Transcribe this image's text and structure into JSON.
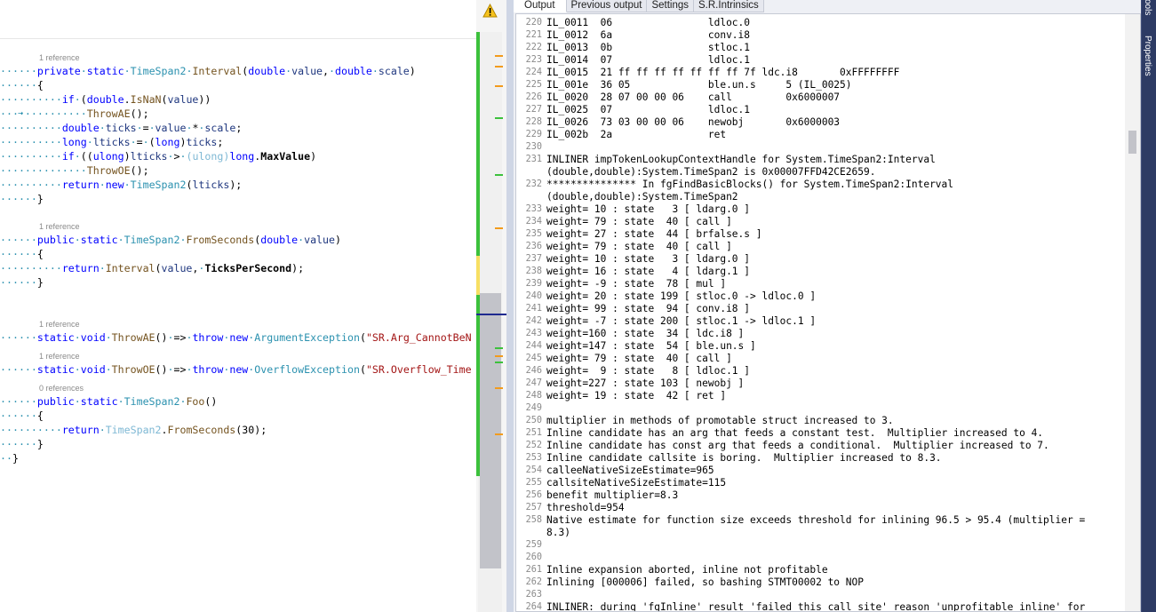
{
  "editor": {
    "lines": [
      {
        "kind": "lens",
        "text": "1 reference"
      },
      {
        "kind": "code",
        "id": "interval-sig"
      },
      {
        "kind": "code",
        "id": "brace1"
      },
      {
        "kind": "code",
        "id": "isnan"
      },
      {
        "kind": "code",
        "id": "throwae-call"
      },
      {
        "kind": "code",
        "id": "ticks"
      },
      {
        "kind": "code",
        "id": "lticks"
      },
      {
        "kind": "code",
        "id": "if-max"
      },
      {
        "kind": "code",
        "id": "throwoe-call"
      },
      {
        "kind": "code",
        "id": "return-new"
      },
      {
        "kind": "code",
        "id": "brace1-close"
      }
    ],
    "lens_interval": "1 reference",
    "lens_fromseconds": "1 reference",
    "lens_throwae": "1 reference",
    "lens_throwoe": "1 reference",
    "lens_foo": "0 references",
    "code": {
      "interval_kw1": "private",
      "interval_kw2": "static",
      "interval_type": "TimeSpan2",
      "interval_name": "Interval",
      "interval_double1": "double",
      "interval_p1": "value",
      "interval_double2": "double",
      "interval_p2": "scale",
      "if1": "if",
      "isnan_double": "double",
      "isnan_method": "IsNaN",
      "isnan_arg": "value",
      "throwae": "ThrowAE",
      "ticks_type": "double",
      "ticks_var": "ticks",
      "ticks_value": "value",
      "ticks_scale": "scale",
      "lticks_type": "long",
      "lticks_var": "lticks",
      "lticks_cast": "long",
      "lticks_src": "ticks",
      "if2": "if",
      "ulong1": "ulong",
      "if2_var": "lticks",
      "ulong2": "ulong",
      "long_kw": "long",
      "maxvalue": "MaxValue",
      "throwoe": "ThrowOE",
      "return1": "return",
      "new1": "new",
      "ret_type": "TimeSpan2",
      "ret_arg": "lticks",
      "fs_kw1": "public",
      "fs_kw2": "static",
      "fs_type": "TimeSpan2",
      "fs_name": "FromSeconds",
      "fs_double": "double",
      "fs_p": "value",
      "return2": "return",
      "fs_call": "Interval",
      "fs_arg1": "value",
      "fs_arg2": "TicksPerSecond",
      "ae_kw1": "static",
      "ae_kw2": "void",
      "ae_name": "ThrowAE",
      "ae_throw": "throw",
      "ae_new": "new",
      "ae_type": "ArgumentException",
      "ae_str": "\"SR.Arg_CannotBeN",
      "oe_kw1": "static",
      "oe_kw2": "void",
      "oe_name": "ThrowOE",
      "oe_throw": "throw",
      "oe_new": "new",
      "oe_type": "OverflowException",
      "oe_str": "\"SR.Overflow_Time",
      "foo_kw1": "public",
      "foo_kw2": "static",
      "foo_type": "TimeSpan2",
      "foo_name": "Foo",
      "return3": "return",
      "foo_ret_type": "TimeSpan2",
      "foo_ret_method": "FromSeconds",
      "foo_ret_arg": "30"
    }
  },
  "output": {
    "tabs": [
      "Output",
      "Previous output",
      "Settings",
      "S.R.Intrinsics"
    ],
    "active_tab": "Output",
    "lines": [
      {
        "n": "220",
        "t": "IL_0011  06                ldloc.0"
      },
      {
        "n": "221",
        "t": "IL_0012  6a                conv.i8"
      },
      {
        "n": "222",
        "t": "IL_0013  0b                stloc.1"
      },
      {
        "n": "223",
        "t": "IL_0014  07                ldloc.1"
      },
      {
        "n": "224",
        "t": "IL_0015  21 ff ff ff ff ff ff ff 7f ldc.i8       0xFFFFFFFF"
      },
      {
        "n": "225",
        "t": "IL_001e  36 05             ble.un.s     5 (IL_0025)"
      },
      {
        "n": "226",
        "t": "IL_0020  28 07 00 00 06    call         0x6000007"
      },
      {
        "n": "227",
        "t": "IL_0025  07                ldloc.1"
      },
      {
        "n": "228",
        "t": "IL_0026  73 03 00 00 06    newobj       0x6000003"
      },
      {
        "n": "229",
        "t": "IL_002b  2a                ret"
      },
      {
        "n": "230",
        "t": ""
      },
      {
        "n": "231",
        "t": "INLINER impTokenLookupContextHandle for System.TimeSpan2:Interval"
      },
      {
        "n": "",
        "t": "(double,double):System.TimeSpan2 is 0x00007FFD42CE2659."
      },
      {
        "n": "232",
        "t": "*************** In fgFindBasicBlocks() for System.TimeSpan2:Interval"
      },
      {
        "n": "",
        "t": "(double,double):System.TimeSpan2"
      },
      {
        "n": "233",
        "t": "weight= 10 : state   3 [ ldarg.0 ]"
      },
      {
        "n": "234",
        "t": "weight= 79 : state  40 [ call ]"
      },
      {
        "n": "235",
        "t": "weight= 27 : state  44 [ brfalse.s ]"
      },
      {
        "n": "236",
        "t": "weight= 79 : state  40 [ call ]"
      },
      {
        "n": "237",
        "t": "weight= 10 : state   3 [ ldarg.0 ]"
      },
      {
        "n": "238",
        "t": "weight= 16 : state   4 [ ldarg.1 ]"
      },
      {
        "n": "239",
        "t": "weight= -9 : state  78 [ mul ]"
      },
      {
        "n": "240",
        "t": "weight= 20 : state 199 [ stloc.0 -> ldloc.0 ]"
      },
      {
        "n": "241",
        "t": "weight= 99 : state  94 [ conv.i8 ]"
      },
      {
        "n": "242",
        "t": "weight= -7 : state 200 [ stloc.1 -> ldloc.1 ]"
      },
      {
        "n": "243",
        "t": "weight=160 : state  34 [ ldc.i8 ]"
      },
      {
        "n": "244",
        "t": "weight=147 : state  54 [ ble.un.s ]"
      },
      {
        "n": "245",
        "t": "weight= 79 : state  40 [ call ]"
      },
      {
        "n": "246",
        "t": "weight=  9 : state   8 [ ldloc.1 ]"
      },
      {
        "n": "247",
        "t": "weight=227 : state 103 [ newobj ]"
      },
      {
        "n": "248",
        "t": "weight= 19 : state  42 [ ret ]"
      },
      {
        "n": "249",
        "t": ""
      },
      {
        "n": "250",
        "t": "multiplier in methods of promotable struct increased to 3."
      },
      {
        "n": "251",
        "t": "Inline candidate has an arg that feeds a constant test.  Multiplier increased to 4."
      },
      {
        "n": "252",
        "t": "Inline candidate has const arg that feeds a conditional.  Multiplier increased to 7."
      },
      {
        "n": "253",
        "t": "Inline candidate callsite is boring.  Multiplier increased to 8.3."
      },
      {
        "n": "254",
        "t": "calleeNativeSizeEstimate=965"
      },
      {
        "n": "255",
        "t": "callsiteNativeSizeEstimate=115"
      },
      {
        "n": "256",
        "t": "benefit multiplier=8.3"
      },
      {
        "n": "257",
        "t": "threshold=954"
      },
      {
        "n": "258",
        "t": "Native estimate for function size exceeds threshold for inlining 96.5 > 95.4 (multiplier ="
      },
      {
        "n": "",
        "t": "8.3)"
      },
      {
        "n": "259",
        "t": ""
      },
      {
        "n": "260",
        "t": ""
      },
      {
        "n": "261",
        "t": "Inline expansion aborted, inline not profitable"
      },
      {
        "n": "262",
        "t": "Inlining [000006] failed, so bashing STMT00002 to NOP"
      },
      {
        "n": "263",
        "t": ""
      },
      {
        "n": "264",
        "t": "INLINER: during 'fgInline' result 'failed this call site' reason 'unprofitable inline' for"
      }
    ]
  },
  "toolstrip": {
    "items": [
      "Tools",
      "Properties"
    ]
  },
  "colors": {
    "keyword": "#0000ff",
    "type": "#2b91af",
    "method": "#74531f",
    "parameter": "#1f377f",
    "string": "#a31515",
    "change_green": "#3cc13c",
    "change_yellow": "#f7df63",
    "marker_orange": "#f29b1d",
    "toolstrip_bg": "#2d3b64"
  }
}
